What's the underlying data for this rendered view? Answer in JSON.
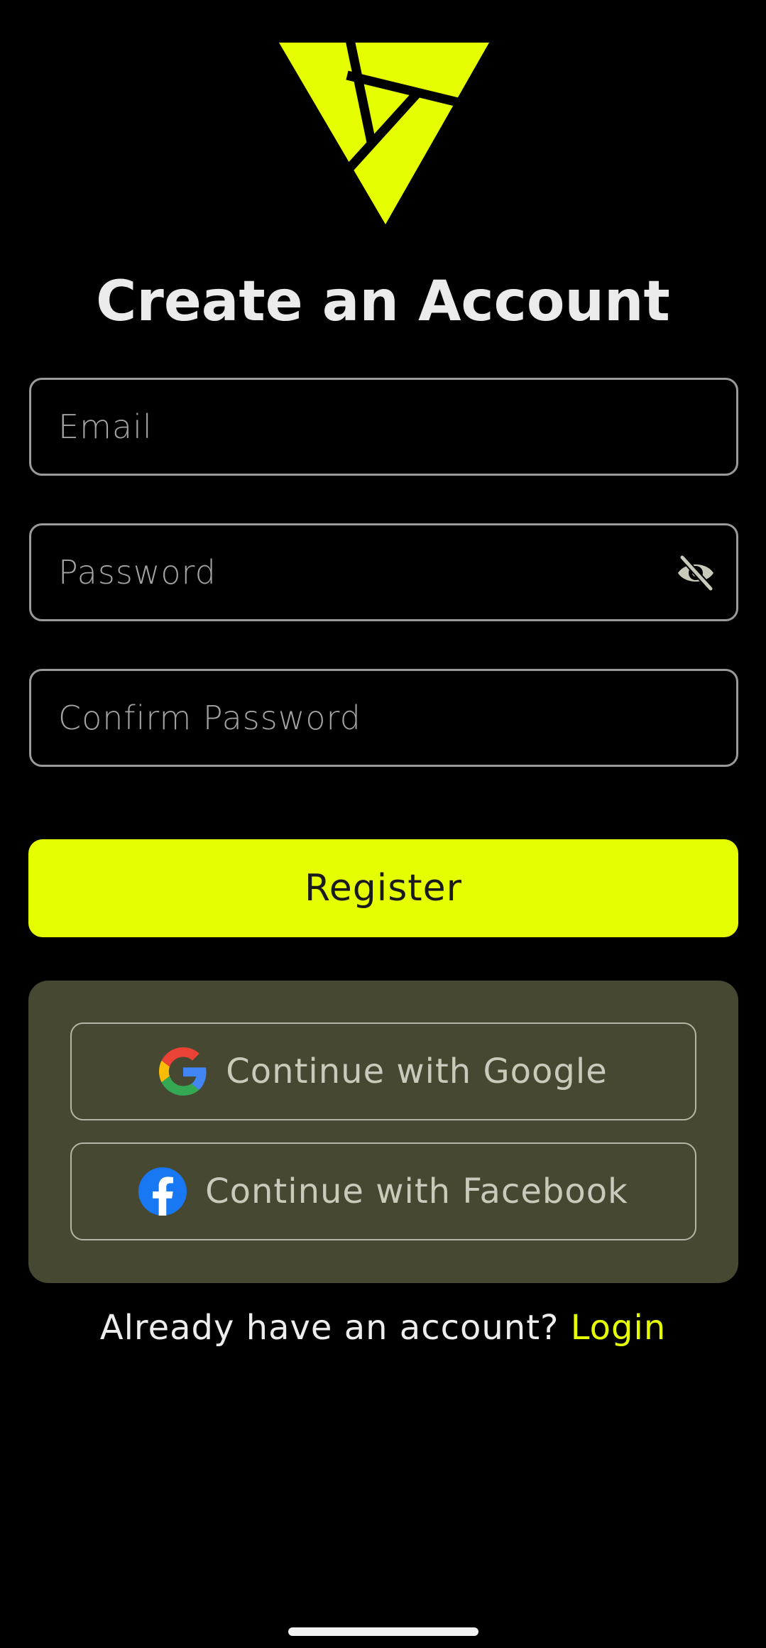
{
  "brand": {
    "accent_color": "#e6ff00",
    "logo_icon": "triangle-logo-icon"
  },
  "header": {
    "title": "Create an Account"
  },
  "form": {
    "email_placeholder": "Email",
    "password_placeholder": "Password",
    "password_toggle_icon": "eye-slash-icon",
    "confirm_password_placeholder": "Confirm Password",
    "register_label": "Register"
  },
  "social": {
    "google_label": "Continue with Google",
    "google_icon": "google-icon",
    "facebook_label": "Continue with Facebook",
    "facebook_icon": "facebook-icon"
  },
  "footer": {
    "prompt": "Already have an account? ",
    "login_label": "Login"
  }
}
